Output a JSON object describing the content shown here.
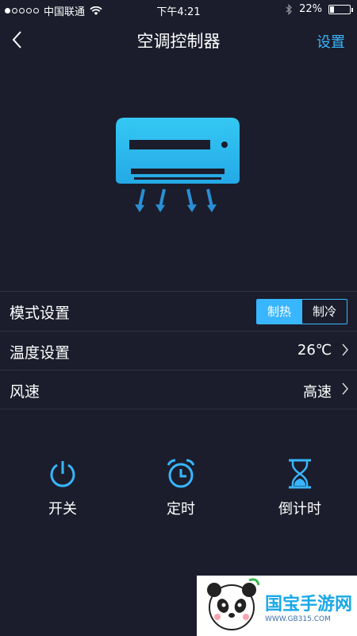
{
  "status_bar": {
    "carrier": "中国联通",
    "time": "下午4:21",
    "battery": "22%",
    "battery_level": 0.22
  },
  "nav": {
    "title": "空调控制器",
    "settings_label": "设置"
  },
  "colors": {
    "accent": "#38b6ff",
    "background": "#1b1d2c"
  },
  "rows": {
    "mode": {
      "label": "模式设置",
      "options": [
        "制热",
        "制冷"
      ],
      "selected": "制热"
    },
    "temperature": {
      "label": "温度设置",
      "value": "26℃"
    },
    "fan": {
      "label": "风速",
      "value": "高速"
    }
  },
  "actions": [
    {
      "label": "开关",
      "icon": "power-icon"
    },
    {
      "label": "定时",
      "icon": "alarm-clock-icon"
    },
    {
      "label": "倒计时",
      "icon": "hourglass-icon"
    }
  ],
  "watermark": {
    "text": "国宝手游网",
    "url": "WWW.GB315.COM"
  }
}
